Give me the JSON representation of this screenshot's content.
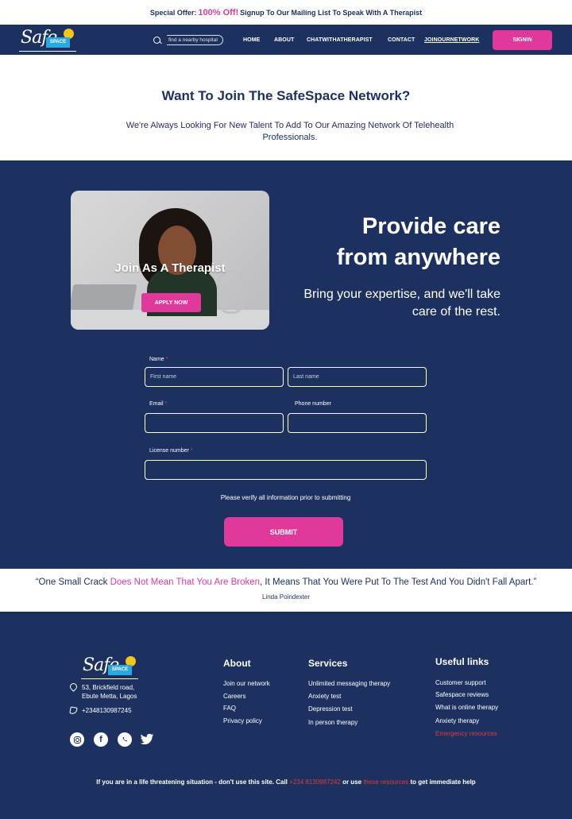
{
  "promo": {
    "prefix": "Special Offer:",
    "highlight": "100% Off!",
    "suffix": "Signup To Our Mailing List To Speak With A Therapist"
  },
  "brand": {
    "script": "Safe",
    "box": "SPACE"
  },
  "nav": {
    "search_placeholder": "find a nearby hospital",
    "links": [
      "HOME",
      "ABOUT",
      "CHATWITHATHERAPIST",
      "CONTACT",
      "JOINOURNETWORK"
    ],
    "signin": "SIGNIN"
  },
  "intro": {
    "title": "Want To Join The SafeSpace Network?",
    "subtitle": "We're Always Looking For New Talent To Add To Our Amazing Network Of Telehealth Professionals."
  },
  "hero": {
    "card_title": "Join As A Therapist",
    "apply_button": "APPLY NOW",
    "heading_line1": "Provide care",
    "heading_line2": "from anywhere",
    "tagline": "Bring your expertise, and we'll take care of the rest."
  },
  "form": {
    "name_label": "Name",
    "first_name_placeholder": "First name",
    "last_name_placeholder": "Last name",
    "email_label": "Email",
    "phone_label": "Phone number",
    "license_label": "License number",
    "required_mark": "*",
    "verify_text": "Please verify all information prior to submitting",
    "submit": "SUBMIT"
  },
  "quote": {
    "open": "“One Small Crack ",
    "pink": "Does Not Mean That You Are Broken",
    "rest": ", It Means That You Were Put To The Test And You Didn't Fall Apart.”",
    "author": "Linda Poindexter"
  },
  "footer": {
    "address_line1": "53, Brickfield road,",
    "address_line2": "Ebute Metta, Lagos",
    "phone": "+2348130987245",
    "about_title": "About",
    "about_links": [
      "Join our network",
      "Careers",
      "FAQ",
      "Privacy policy"
    ],
    "services_title": "Services",
    "services_links": [
      "Unlimited messaging therapy",
      "Anxiety test",
      "Depression test",
      "In person therapy"
    ],
    "useful_title": "Useful links",
    "useful_links": [
      "Customer support",
      "Safespace reviews",
      "What is online therapy",
      "Anxiety therapy",
      "Emergency resources"
    ],
    "disclaimer_a": "If you are in a life threatening situation - don't use this site. Call ",
    "disclaimer_phone": "+234 8130987242",
    "disclaimer_b": " or use ",
    "disclaimer_link": "these resources",
    "disclaimer_c": " to get immediate help"
  },
  "colors": {
    "navy": "#1d3161",
    "pink": "#e0399b",
    "red": "#e03a3a",
    "sky": "#29a9e0",
    "sun": "#f5c518"
  },
  "icons": [
    "search-icon",
    "map-pin-icon",
    "phone-icon",
    "instagram-icon",
    "facebook-icon",
    "whatsapp-icon",
    "twitter-icon"
  ]
}
